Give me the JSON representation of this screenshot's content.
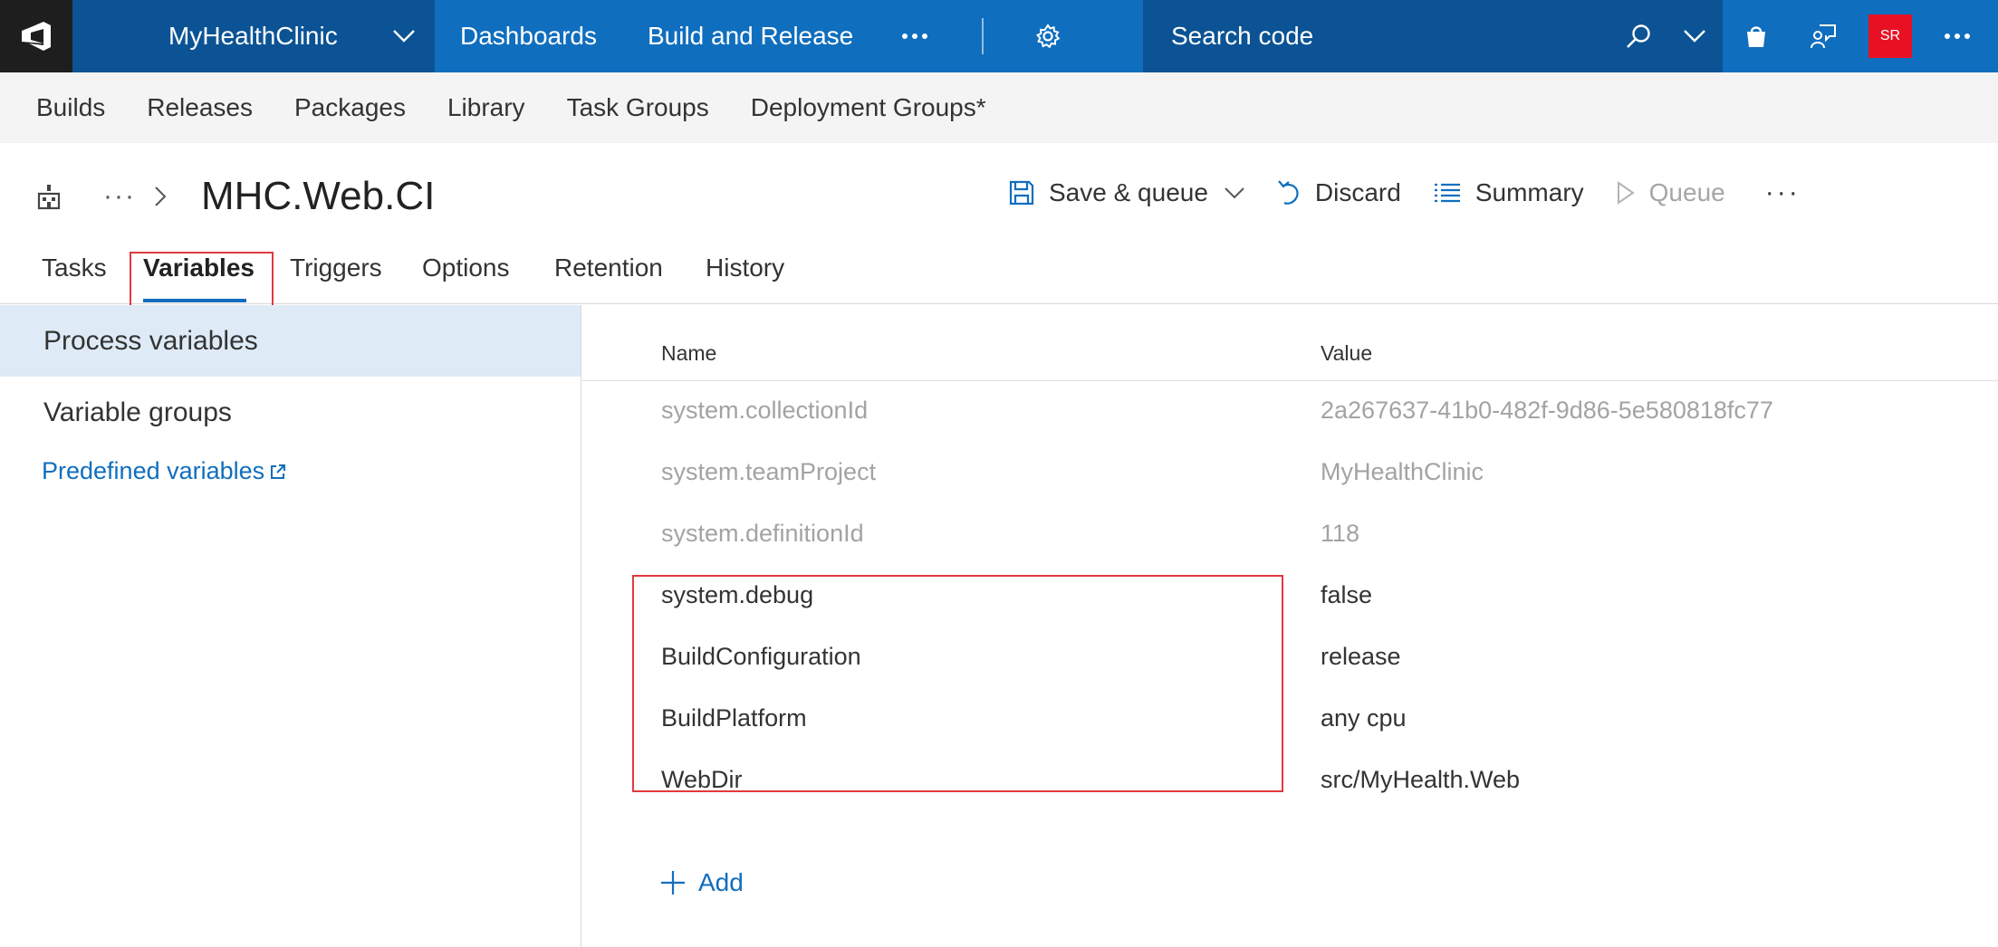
{
  "topbar": {
    "project": "MyHealthClinic",
    "hubs": [
      "Dashboards",
      "Build and Release"
    ],
    "search_placeholder": "Search code",
    "avatar_initials": "SR",
    "colors": {
      "bar": "#106ebe",
      "dark": "#0b5394",
      "logo_bg": "#1e1e1e",
      "avatar": "#e81123"
    }
  },
  "subnav": {
    "items": [
      "Builds",
      "Releases",
      "Packages",
      "Library",
      "Task Groups",
      "Deployment Groups*"
    ]
  },
  "header": {
    "title": "MHC.Web.CI",
    "breadcrumb_more": "···"
  },
  "toolbar": {
    "save_queue": "Save & queue",
    "discard": "Discard",
    "summary": "Summary",
    "queue": "Queue",
    "more": "···"
  },
  "tabs": [
    "Tasks",
    "Variables",
    "Triggers",
    "Options",
    "Retention",
    "History"
  ],
  "active_tab": "Variables",
  "left_panel": {
    "process_variables": "Process variables",
    "variable_groups": "Variable groups",
    "predefined_variables": "Predefined variables"
  },
  "table": {
    "col_name": "Name",
    "col_value": "Value",
    "rows": [
      {
        "name": "system.collectionId",
        "value": "2a267637-41b0-482f-9d86-5e580818fc77"
      },
      {
        "name": "system.teamProject",
        "value": "MyHealthClinic"
      },
      {
        "name": "system.definitionId",
        "value": "118"
      },
      {
        "name": "system.debug",
        "value": "false"
      },
      {
        "name": "BuildConfiguration",
        "value": "release"
      },
      {
        "name": "BuildPlatform",
        "value": "any cpu"
      },
      {
        "name": "WebDir",
        "value": "src/MyHealth.Web"
      }
    ]
  },
  "add_label": "Add",
  "colors": {
    "accent": "#106ebe",
    "highlight": "#e0393e",
    "selected_bg": "#deebf7"
  }
}
